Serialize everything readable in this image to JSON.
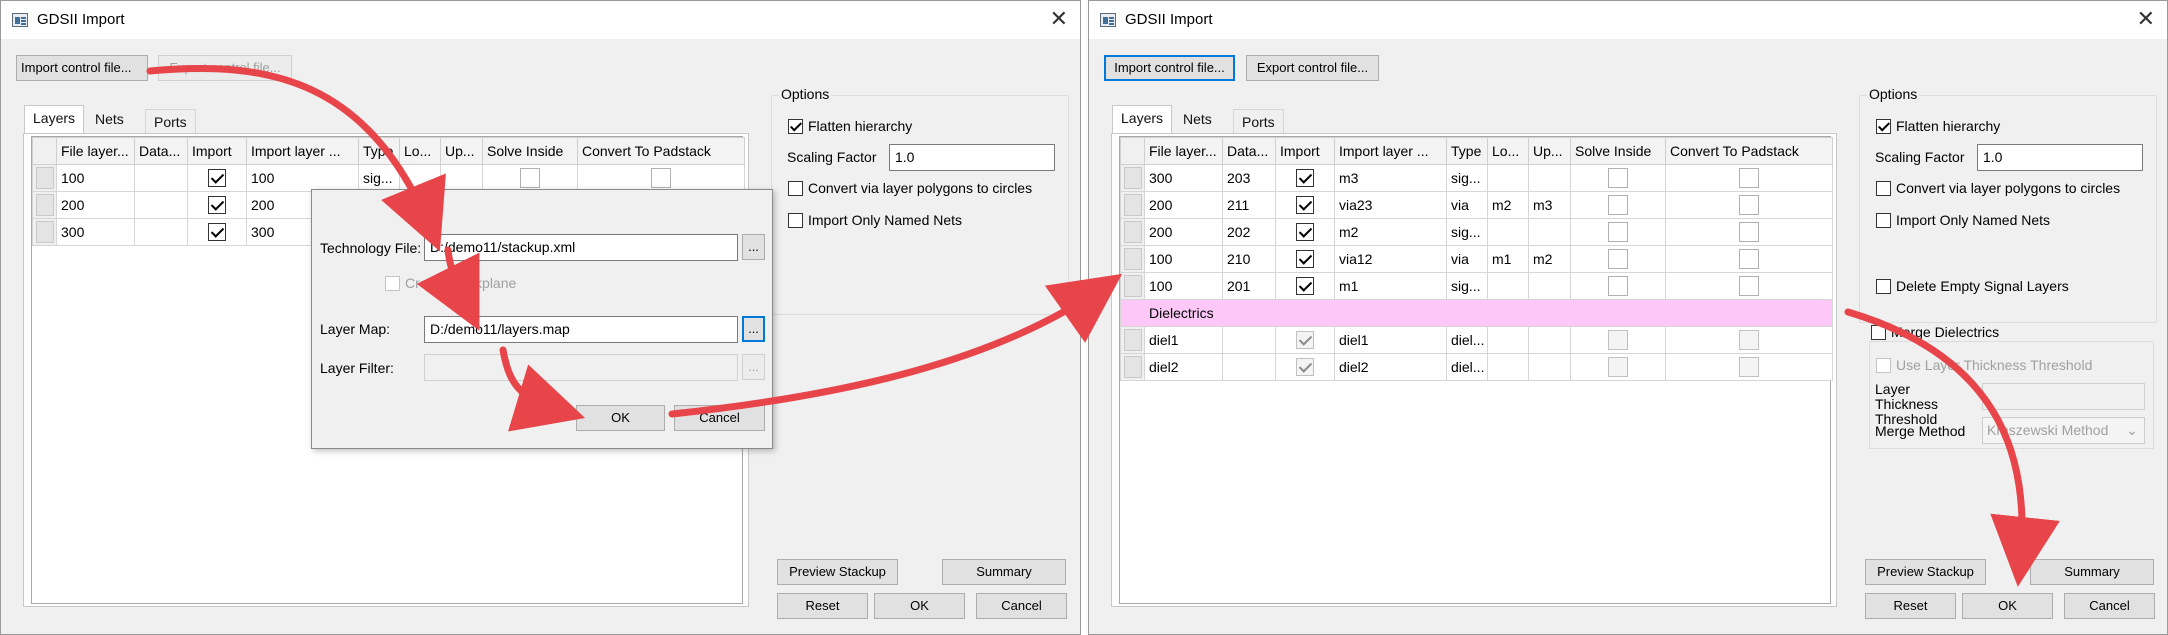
{
  "left": {
    "title": "GDSII Import",
    "close_glyph": "✕",
    "import_control_label": "Import control file...",
    "export_control_label": "Export control file...",
    "tabs": [
      "Layers",
      "Nets",
      "Ports"
    ],
    "columns": [
      "File layer...",
      "Data...",
      "Import",
      "Import layer ...",
      "Type",
      "Lo...",
      "Up...",
      "Solve Inside",
      "Convert To Padstack"
    ],
    "rows": [
      {
        "file_layer": "100",
        "data": "",
        "import": true,
        "import_layer": "100",
        "type": "sig...",
        "lo": "",
        "up": ""
      },
      {
        "file_layer": "200",
        "data": "",
        "import": true,
        "import_layer": "200",
        "type": "",
        "lo": "",
        "up": ""
      },
      {
        "file_layer": "300",
        "data": "",
        "import": true,
        "import_layer": "300",
        "type": "",
        "lo": "",
        "up": ""
      }
    ],
    "options": {
      "title": "Options",
      "flatten_hierarchy": {
        "label": "Flatten hierarchy",
        "checked": true
      },
      "scaling_factor_label": "Scaling Factor",
      "scaling_factor_value": "1.0",
      "convert_via": {
        "label": "Convert via layer polygons to circles",
        "checked": false
      },
      "import_named_nets": {
        "label": "Import Only Named Nets",
        "checked": false
      }
    },
    "preview_stackup_label": "Preview Stackup",
    "summary_label": "Summary",
    "reset_label": "Reset",
    "ok_label": "OK",
    "cancel_label": "Cancel"
  },
  "dialog": {
    "technology_file_label": "Technology File:",
    "technology_file_value": "D:/demo11/stackup.xml",
    "create_backplane_label": "Create Backplane",
    "layer_map_label": "Layer Map:",
    "layer_map_value": "D:/demo11/layers.map",
    "layer_filter_label": "Layer Filter:",
    "browse_label": "...",
    "ok_label": "OK",
    "cancel_label": "Cancel"
  },
  "right": {
    "title": "GDSII Import",
    "close_glyph": "✕",
    "import_control_label": "Import control file...",
    "export_control_label": "Export control file...",
    "tabs": [
      "Layers",
      "Nets",
      "Ports"
    ],
    "columns": [
      "File layer...",
      "Data...",
      "Import",
      "Import layer ...",
      "Type",
      "Lo...",
      "Up...",
      "Solve Inside",
      "Convert To Padstack"
    ],
    "rows": [
      {
        "file_layer": "300",
        "data": "203",
        "import": true,
        "import_layer": "m3",
        "type": "sig...",
        "lo": "",
        "up": ""
      },
      {
        "file_layer": "200",
        "data": "211",
        "import": true,
        "import_layer": "via23",
        "type": "via",
        "lo": "m2",
        "up": "m3"
      },
      {
        "file_layer": "200",
        "data": "202",
        "import": true,
        "import_layer": "m2",
        "type": "sig...",
        "lo": "",
        "up": ""
      },
      {
        "file_layer": "100",
        "data": "210",
        "import": true,
        "import_layer": "via12",
        "type": "via",
        "lo": "m1",
        "up": "m2"
      },
      {
        "file_layer": "100",
        "data": "201",
        "import": true,
        "import_layer": "m1",
        "type": "sig...",
        "lo": "",
        "up": ""
      }
    ],
    "dielectrics_label": "Dielectrics",
    "diel_rows": [
      {
        "file_layer": "diel1",
        "data": "",
        "import": true,
        "import_layer": "diel1",
        "type": "diel...",
        "lo": "",
        "up": ""
      },
      {
        "file_layer": "diel2",
        "data": "",
        "import": true,
        "import_layer": "diel2",
        "type": "diel...",
        "lo": "",
        "up": ""
      }
    ],
    "options": {
      "title": "Options",
      "flatten_hierarchy": {
        "label": "Flatten hierarchy",
        "checked": true
      },
      "scaling_factor_label": "Scaling Factor",
      "scaling_factor_value": "1.0",
      "convert_via": {
        "label": "Convert via layer polygons to circles",
        "checked": false
      },
      "import_named_nets": {
        "label": "Import Only Named Nets",
        "checked": false
      },
      "delete_empty_signal": {
        "label": "Delete Empty Signal Layers",
        "checked": false
      },
      "merge_dielectrics": {
        "label": "Merge Dielectrics",
        "checked": false
      },
      "use_layer_thickness": {
        "label": "Use Layer Thickness Threshold",
        "checked": false
      },
      "layer_thickness_label": "Layer Thickness Threshold",
      "merge_method_label": "Merge Method",
      "merge_method_value": "Kraszewski Method"
    },
    "preview_stackup_label": "Preview Stackup",
    "summary_label": "Summary",
    "reset_label": "Reset",
    "ok_label": "OK",
    "cancel_label": "Cancel"
  },
  "colors": {
    "arrow": "#e8454a",
    "dielectric_row": "#fdc8f8",
    "focus_border": "#0078d7"
  },
  "icons": [
    "app-window-icon",
    "close-icon",
    "checkbox-icon",
    "arrow-icon",
    "dropdown-arrow-icon"
  ]
}
